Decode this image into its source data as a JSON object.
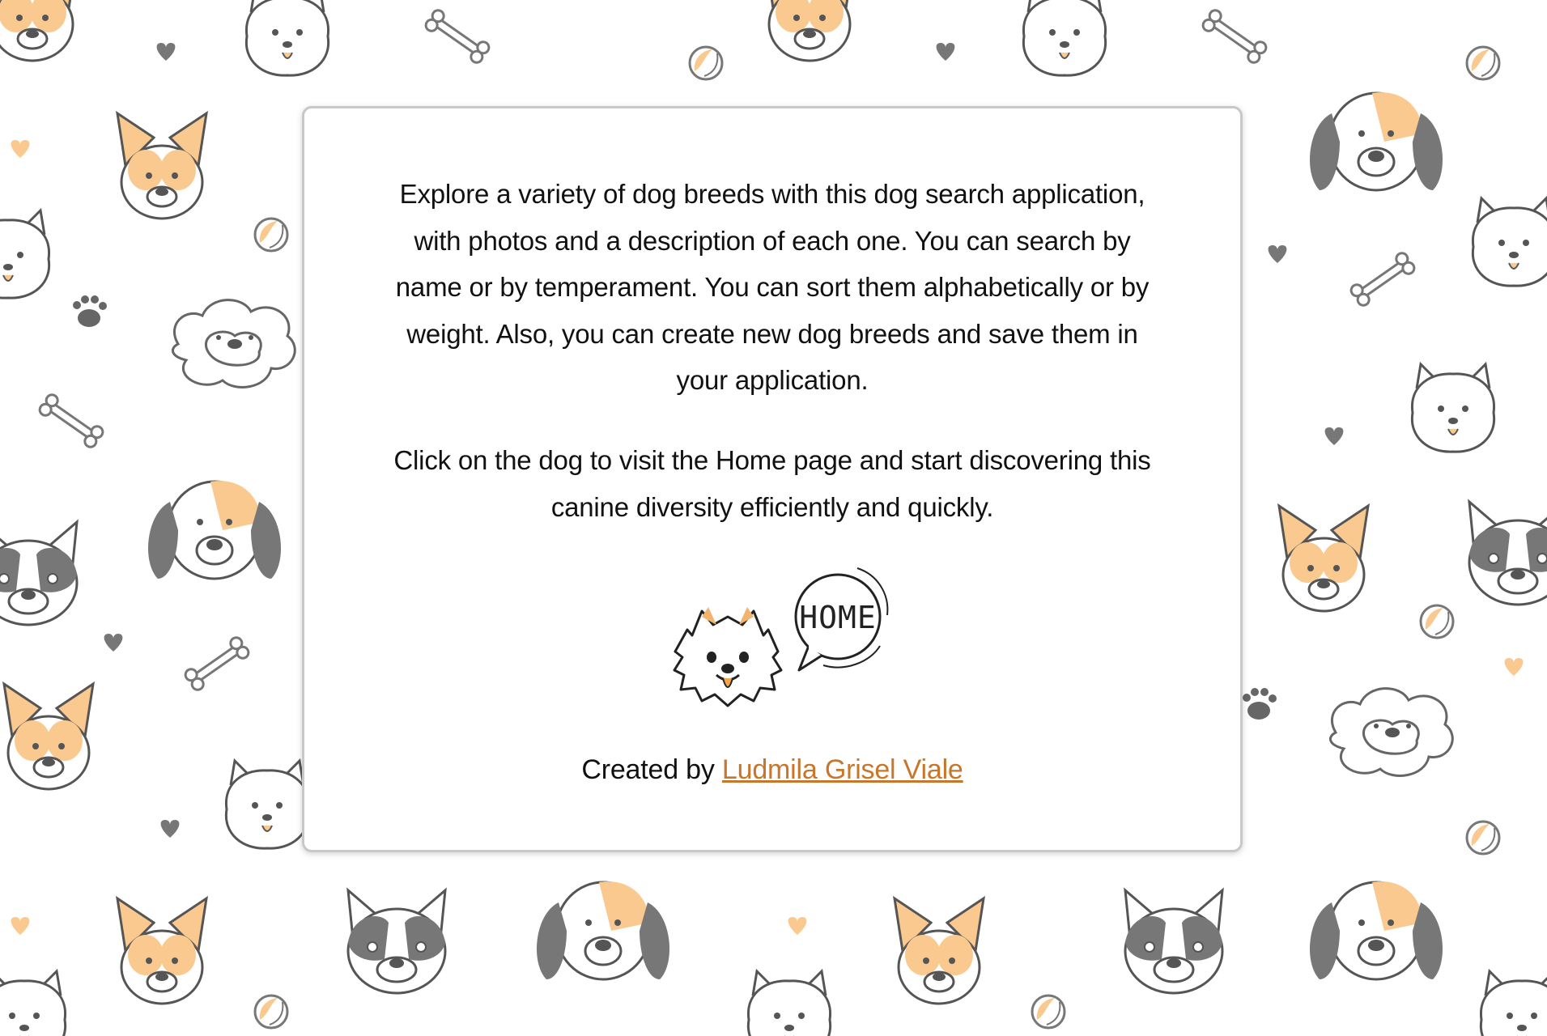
{
  "intro": {
    "paragraph_1": "Explore a variety of dog breeds with this dog search application, with photos and a description of each one. You can search by name or by temperament. You can sort them alphabetically or by weight. Also, you can create new dog breeds and save them in your application.",
    "paragraph_2": "Click on the dog to visit the Home page and start discovering this canine diversity efficiently and quickly."
  },
  "home_button": {
    "label": "HOME",
    "icon": "spitz-dog-icon"
  },
  "footer": {
    "created_by": "Created by ",
    "author": "Ludmila Grisel Viale"
  },
  "colors": {
    "background": "#ffffff",
    "pattern_accent": "#f9c98f",
    "pattern_gray": "#7a7a7a",
    "link": "#c8762a",
    "text": "#111111"
  }
}
